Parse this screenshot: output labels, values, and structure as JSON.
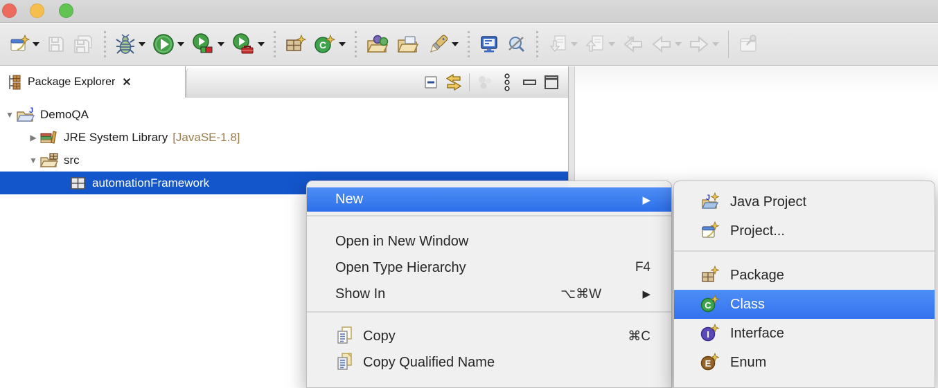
{
  "window": {
    "controls": [
      "close",
      "minimize",
      "zoom"
    ]
  },
  "toolbar": {
    "icons": [
      "new-wizard",
      "save",
      "save-all",
      "debug",
      "run",
      "coverage",
      "run-external-tools",
      "new-java-package",
      "new-java-class",
      "open-task",
      "open-resource",
      "highlight",
      "open-console",
      "last-edit-location",
      "import",
      "export",
      "previous-annotation",
      "back",
      "forward",
      "pin-editor"
    ]
  },
  "package_explorer": {
    "tab": {
      "title": "Package Explorer"
    },
    "view_toolbar_icons": [
      "collapse-all",
      "link-with-editor",
      "focus",
      "view-menu",
      "minimize",
      "maximize"
    ],
    "tree": {
      "items": [
        {
          "label": "DemoQA",
          "state": "expanded",
          "icon": "java-project-icon",
          "selected": false
        },
        {
          "label": "JRE System Library",
          "qualifier": "[JavaSE-1.8]",
          "state": "collapsed",
          "icon": "jre-library-icon",
          "selected": false
        },
        {
          "label": "src",
          "state": "expanded",
          "icon": "source-folder-icon",
          "selected": false
        },
        {
          "label": "automationFramework",
          "state": "leaf",
          "icon": "package-icon",
          "selected": true
        }
      ]
    }
  },
  "context_menu": {
    "items": [
      {
        "label": "New",
        "has_submenu": true,
        "highlighted": true,
        "submenu_arrow": "▶"
      },
      {
        "label": "Open in New Window"
      },
      {
        "label": "Open Type Hierarchy",
        "shortcut": "F4"
      },
      {
        "label": "Show In",
        "shortcut": "⌥⌘W",
        "has_submenu": true,
        "submenu_arrow": "▶"
      },
      {
        "label": "Copy",
        "shortcut": "⌘C",
        "icon": "copy-icon"
      },
      {
        "label": "Copy Qualified Name",
        "icon": "copy-qualified-name-icon"
      }
    ]
  },
  "new_submenu": {
    "items": [
      {
        "label": "Java Project",
        "icon": "new-java-project-icon"
      },
      {
        "label": "Project...",
        "icon": "new-project-icon"
      },
      {
        "label": "Package",
        "icon": "new-package-icon"
      },
      {
        "label": "Class",
        "icon": "new-class-icon",
        "highlighted": true
      },
      {
        "label": "Interface",
        "icon": "new-interface-icon"
      },
      {
        "label": "Enum",
        "icon": "new-enum-icon"
      }
    ]
  },
  "colors": {
    "tree_selection_blue": "#1355cb",
    "menu_highlight_blue": "#3b7cf3",
    "qualifier_gold": "#9b7d4b",
    "traffic_red": "#ec6a5e",
    "traffic_yellow": "#f5bf4f",
    "traffic_green": "#61c354"
  }
}
